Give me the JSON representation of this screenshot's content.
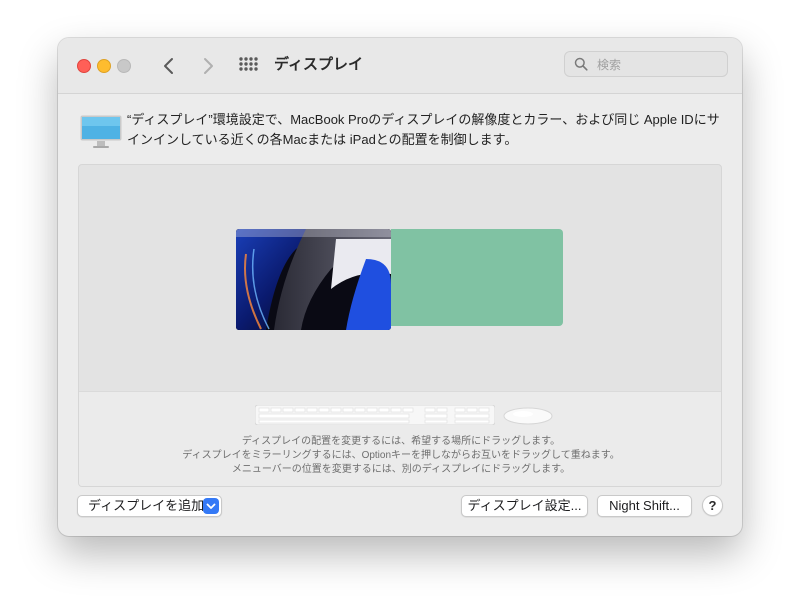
{
  "window": {
    "title": "ディスプレイ"
  },
  "toolbar": {
    "back_icon": "chevron-left-icon",
    "forward_icon": "chevron-right-icon",
    "grid_icon": "show-all-grid-icon",
    "search_placeholder": "検索"
  },
  "description": {
    "text": "“ディスプレイ”環境設定で、MacBook Proのディスプレイの解像度とカラー、および同じ Apple IDにサインインしている近くの各Macまたは iPadとの配置を制御します。",
    "icon": "display-monitor-icon"
  },
  "arrangement": {
    "colors": {
      "secondary_display": "#80c2a3",
      "background": "#e3e3e3"
    },
    "hints": [
      "ディスプレイの配置を変更するには、希望する場所にドラッグします。",
      "ディスプレイをミラーリングするには、Optionキーを押しながらお互いをドラッグして重ねます。",
      "メニューバーの位置を変更するには、別のディスプレイにドラッグします。"
    ]
  },
  "buttons": {
    "add_display": "ディスプレイを追加",
    "display_settings": "ディスプレイ設定...",
    "night_shift": "Night Shift...",
    "help": "?"
  }
}
